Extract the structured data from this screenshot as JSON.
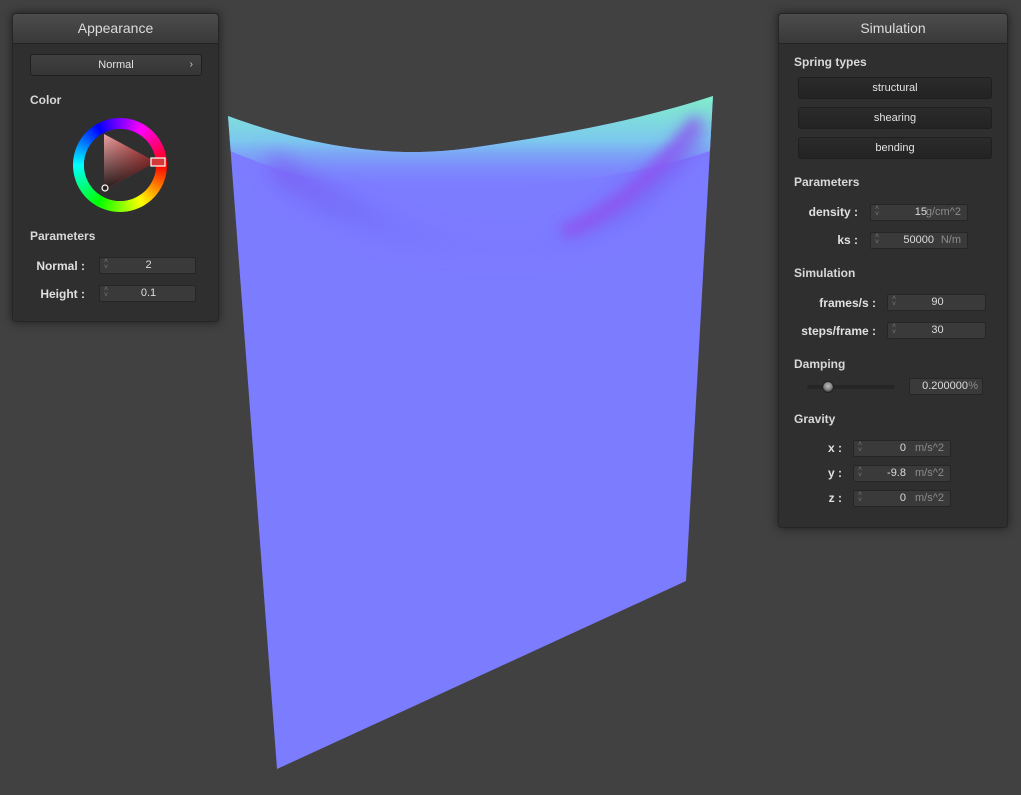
{
  "appearance": {
    "title": "Appearance",
    "shader_select": {
      "value": "Normal",
      "icon": "chevron-right-icon"
    },
    "color_label": "Color",
    "parameters_label": "Parameters",
    "fields": [
      {
        "label": "Normal :",
        "value": "2"
      },
      {
        "label": "Height :",
        "value": "0.1"
      }
    ]
  },
  "simulation": {
    "title": "Simulation",
    "spring_types_label": "Spring types",
    "spring_types": [
      "structural",
      "shearing",
      "bending"
    ],
    "parameters_label": "Parameters",
    "parameters": [
      {
        "label": "density :",
        "value": "15",
        "unit": "g/cm^2"
      },
      {
        "label": "ks :",
        "value": "50000",
        "unit": "N/m"
      }
    ],
    "simulation_label": "Simulation",
    "sim_fields": [
      {
        "label": "frames/s :",
        "value": "90"
      },
      {
        "label": "steps/frame :",
        "value": "30"
      }
    ],
    "damping_label": "Damping",
    "damping": {
      "value": "0.200000",
      "unit": "%",
      "slider_fraction": 0.2
    },
    "gravity_label": "Gravity",
    "gravity": [
      {
        "label": "x :",
        "value": "0",
        "unit": "m/s^2"
      },
      {
        "label": "y :",
        "value": "-9.8",
        "unit": "m/s^2"
      },
      {
        "label": "z :",
        "value": "0",
        "unit": "m/s^2"
      }
    ]
  },
  "colors": {
    "background": "#414141",
    "cloth_base": "#7c7cff",
    "cloth_fold": "#8f52f0",
    "cloth_top": "#7ff0c8",
    "picked_color": "#d43838"
  },
  "icons": {
    "color_wheel": "color-wheel-icon",
    "spinner": "spinner-arrows-icon"
  }
}
